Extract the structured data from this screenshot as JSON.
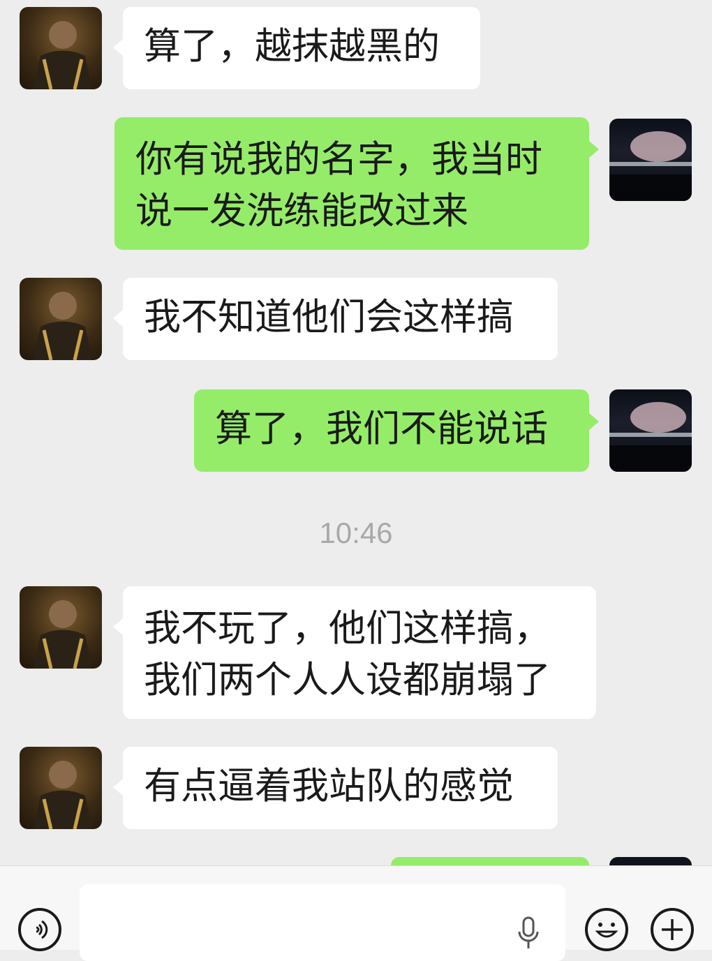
{
  "messages": [
    {
      "side": "left",
      "text": "算了，越抹越黑的"
    },
    {
      "side": "right",
      "lines": [
        "你有说我的名字，我当时",
        "说一发洗练能改过来"
      ]
    },
    {
      "side": "left",
      "text": "我不知道他们会这样搞"
    },
    {
      "side": "right",
      "text": "算了，我们不能说话"
    },
    {
      "side": "left",
      "lines": [
        "我不玩了，他们这样搞，",
        "我们两个人人设都崩塌了"
      ]
    },
    {
      "side": "left",
      "text": "有点逼着我站队的感觉"
    }
  ],
  "timestamp": "10:46",
  "input_bar": {
    "placeholder": "",
    "icons": [
      "voice-icon",
      "microphone-icon",
      "emoji-icon",
      "plus-icon"
    ]
  },
  "colors": {
    "background": "#ededed",
    "incoming_bubble": "#ffffff",
    "outgoing_bubble": "#95ec69"
  }
}
